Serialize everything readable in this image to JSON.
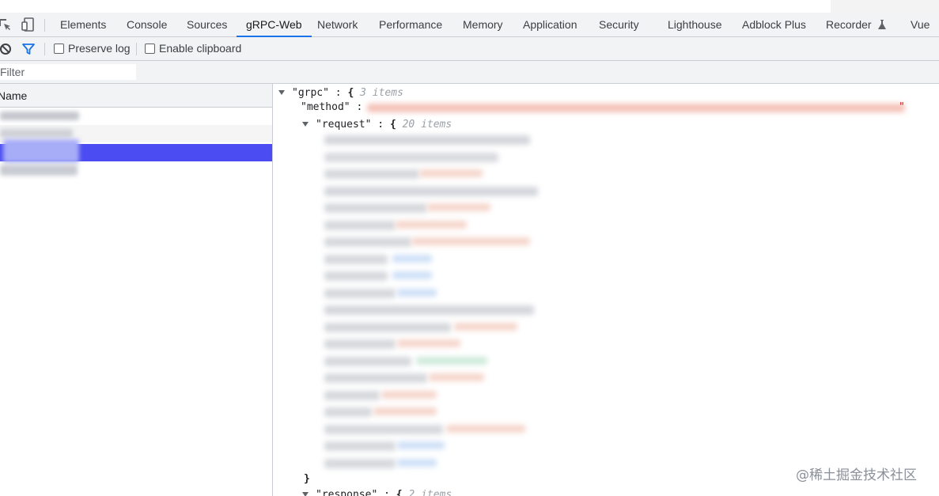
{
  "tabs": [
    {
      "label": "Elements"
    },
    {
      "label": "Console"
    },
    {
      "label": "Sources"
    },
    {
      "label": "gRPC-Web",
      "active": true
    },
    {
      "label": "Network"
    },
    {
      "label": "Performance"
    },
    {
      "label": "Memory"
    },
    {
      "label": "Application"
    },
    {
      "label": "Security"
    },
    {
      "label": "Lighthouse"
    },
    {
      "label": "Adblock Plus"
    },
    {
      "label": "Recorder"
    },
    {
      "label": "Vue"
    }
  ],
  "toolbar": {
    "preserve_log_label": "Preserve log",
    "preserve_log_checked": false,
    "enable_clipboard_label": "Enable clipboard",
    "enable_clipboard_checked": false
  },
  "filter": {
    "placeholder": "Filter",
    "value": ""
  },
  "request_list": {
    "column_header": "Name",
    "selected_row_index": 2
  },
  "json_view": {
    "root_key": "\"grpc\"",
    "root_count": "3 items",
    "method_key": "\"method\"",
    "request_key": "\"request\"",
    "request_count": "20 items",
    "closing_brace": "}",
    "response_key": "\"response\"",
    "response_count": "2 items"
  },
  "watermark": "@稀土掘金技术社区",
  "colors": {
    "accent": "#1a73e8",
    "selected_row": "#4b4cf1"
  }
}
